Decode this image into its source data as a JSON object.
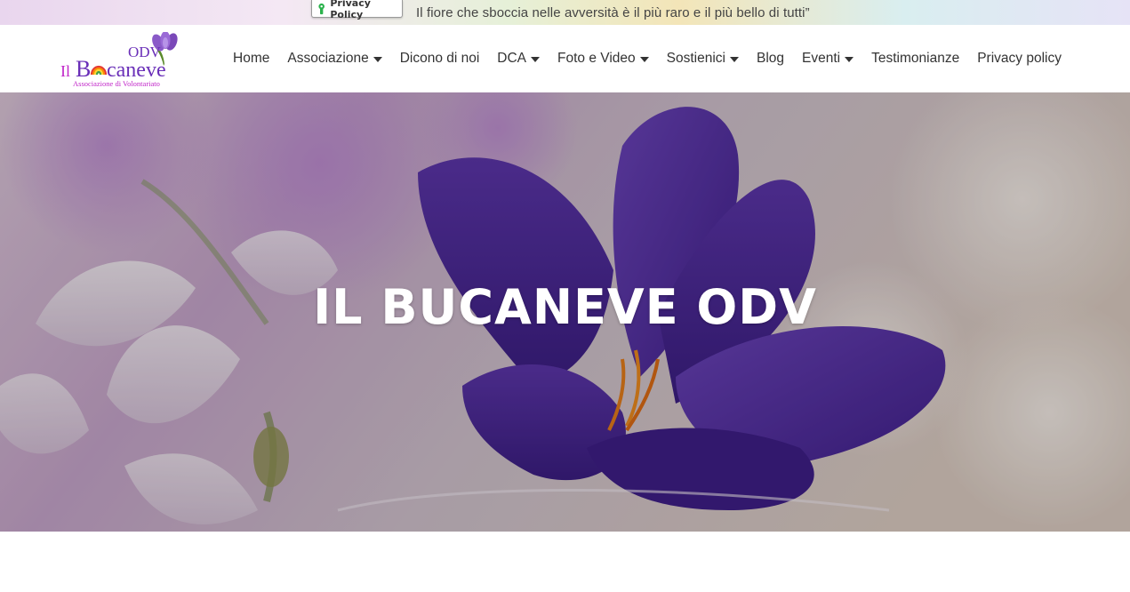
{
  "topbar": {
    "privacy_badge_label": "Privacy Policy",
    "quote": "Il fiore che sboccia nelle avversità è il più raro e il più bello di tutti”"
  },
  "logo": {
    "prefix": "Il",
    "suffix": "ODV",
    "name_b": "B",
    "name_rest": "caneve",
    "tagline": "Associazione di Volontariato"
  },
  "nav": {
    "items": [
      {
        "label": "Home",
        "has_dropdown": false
      },
      {
        "label": "Associazione",
        "has_dropdown": true
      },
      {
        "label": "Dicono di noi",
        "has_dropdown": false
      },
      {
        "label": "DCA",
        "has_dropdown": true
      },
      {
        "label": "Foto e Video",
        "has_dropdown": true
      },
      {
        "label": "Sostienici",
        "has_dropdown": true
      },
      {
        "label": "Blog",
        "has_dropdown": false
      },
      {
        "label": "Eventi",
        "has_dropdown": true
      },
      {
        "label": "Testimonianze",
        "has_dropdown": false
      },
      {
        "label": "Privacy policy",
        "has_dropdown": false
      }
    ]
  },
  "hero": {
    "title": "IL BUCANEVE ODV"
  },
  "colors": {
    "logo_magenta": "#c126c9",
    "logo_purple": "#6a2fb8",
    "text_dark": "#333333",
    "hero_purple": "#4a2596"
  }
}
